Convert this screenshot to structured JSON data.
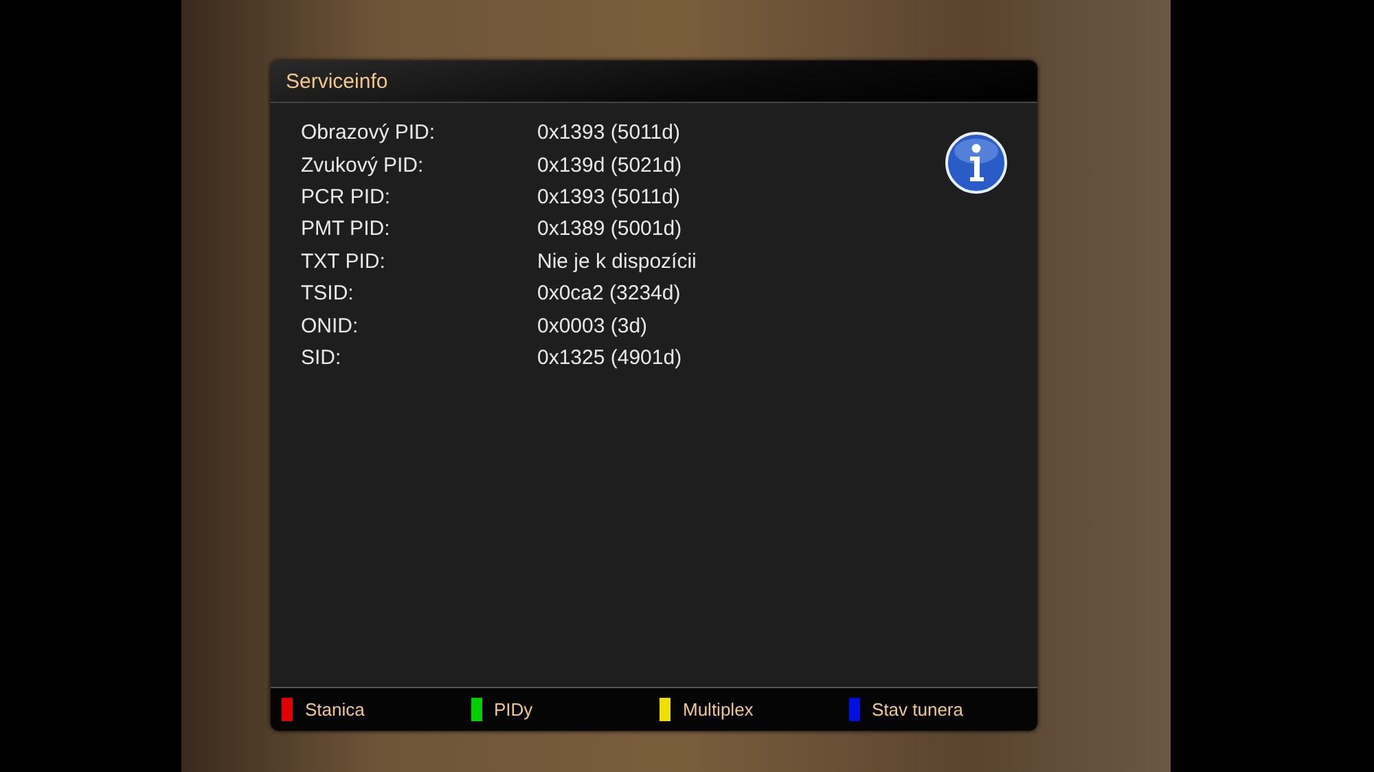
{
  "dialog": {
    "title": "Serviceinfo",
    "rows": [
      {
        "label": "Obrazový PID:",
        "value": "0x1393 (5011d)"
      },
      {
        "label": "Zvukový PID:",
        "value": "0x139d (5021d)"
      },
      {
        "label": "PCR PID:",
        "value": "0x1393 (5011d)"
      },
      {
        "label": "PMT PID:",
        "value": "0x1389 (5001d)"
      },
      {
        "label": "TXT PID:",
        "value": "Nie je k dispozícii"
      },
      {
        "label": "TSID:",
        "value": "0x0ca2 (3234d)"
      },
      {
        "label": "ONID:",
        "value": "0x0003 (3d)"
      },
      {
        "label": "SID:",
        "value": "0x1325 (4901d)"
      }
    ],
    "color_keys": [
      {
        "label": "Stanica",
        "color": "#e00000"
      },
      {
        "label": "PIDy",
        "color": "#00d000"
      },
      {
        "label": "Multiplex",
        "color": "#f0e000"
      },
      {
        "label": "Stav tunera",
        "color": "#0010e0"
      }
    ]
  }
}
